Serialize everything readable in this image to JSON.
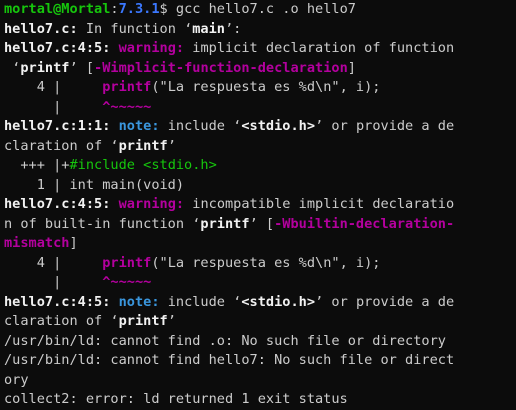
{
  "colors": {
    "background": "#0c0c0c",
    "text": "#cccccc",
    "prompt_user": "#16c60c",
    "prompt_path": "#3b78ff",
    "warning": "#b4009e",
    "note": "#3a96dd",
    "error": "#e74856",
    "fixit": "#16c60c"
  },
  "lines": [
    {
      "segments": [
        {
          "text": "mortal@Mortal",
          "style": "green b"
        },
        {
          "text": ":",
          "style": ""
        },
        {
          "text": "7.3.1",
          "style": "blue b"
        },
        {
          "text": "$ gcc hello7.c .o hello7",
          "style": ""
        }
      ]
    },
    {
      "segments": [
        {
          "text": "hello7.c:",
          "style": "white b"
        },
        {
          "text": " In function ‘",
          "style": ""
        },
        {
          "text": "main",
          "style": "white b"
        },
        {
          "text": "’:",
          "style": ""
        }
      ]
    },
    {
      "segments": [
        {
          "text": "hello7.c:4:5:",
          "style": "white b"
        },
        {
          "text": " ",
          "style": ""
        },
        {
          "text": "warning:",
          "style": "magenta b"
        },
        {
          "text": " implicit declaration of function",
          "style": ""
        }
      ]
    },
    {
      "segments": [
        {
          "text": " ‘",
          "style": ""
        },
        {
          "text": "printf",
          "style": "white b"
        },
        {
          "text": "’ [",
          "style": ""
        },
        {
          "text": "-Wimplicit-function-declaration",
          "style": "magenta b"
        },
        {
          "text": "]",
          "style": ""
        }
      ]
    },
    {
      "segments": [
        {
          "text": "    4 |     ",
          "style": ""
        },
        {
          "text": "printf",
          "style": "magenta b"
        },
        {
          "text": "(\"La respuesta es %d\\n\", i);",
          "style": ""
        }
      ]
    },
    {
      "segments": [
        {
          "text": "      |     ",
          "style": ""
        },
        {
          "text": "^~~~~~",
          "style": "magenta b"
        }
      ]
    },
    {
      "segments": [
        {
          "text": "hello7.c:1:1:",
          "style": "white b"
        },
        {
          "text": " ",
          "style": ""
        },
        {
          "text": "note:",
          "style": "cyan b"
        },
        {
          "text": " include ‘",
          "style": ""
        },
        {
          "text": "<stdio.h>",
          "style": "white b"
        },
        {
          "text": "’ or provide a de",
          "style": ""
        }
      ]
    },
    {
      "segments": [
        {
          "text": "claration of ‘",
          "style": ""
        },
        {
          "text": "printf",
          "style": "white b"
        },
        {
          "text": "’",
          "style": ""
        }
      ]
    },
    {
      "segments": [
        {
          "text": "  +++ |+",
          "style": ""
        },
        {
          "text": "#include <stdio.h>",
          "style": "green"
        }
      ]
    },
    {
      "segments": [
        {
          "text": "    1 | int main(void)",
          "style": ""
        }
      ]
    },
    {
      "segments": [
        {
          "text": "hello7.c:4:5:",
          "style": "white b"
        },
        {
          "text": " ",
          "style": ""
        },
        {
          "text": "warning:",
          "style": "magenta b"
        },
        {
          "text": " incompatible implicit declaratio",
          "style": ""
        }
      ]
    },
    {
      "segments": [
        {
          "text": "n of built-in function ‘",
          "style": ""
        },
        {
          "text": "printf",
          "style": "white b"
        },
        {
          "text": "’ [",
          "style": ""
        },
        {
          "text": "-Wbuiltin-declaration-",
          "style": "magenta b"
        }
      ]
    },
    {
      "segments": [
        {
          "text": "mismatch",
          "style": "magenta b"
        },
        {
          "text": "]",
          "style": ""
        }
      ]
    },
    {
      "segments": [
        {
          "text": "    4 |     ",
          "style": ""
        },
        {
          "text": "printf",
          "style": "magenta b"
        },
        {
          "text": "(\"La respuesta es %d\\n\", i);",
          "style": ""
        }
      ]
    },
    {
      "segments": [
        {
          "text": "      |     ",
          "style": ""
        },
        {
          "text": "^~~~~~",
          "style": "magenta b"
        }
      ]
    },
    {
      "segments": [
        {
          "text": "hello7.c:4:5:",
          "style": "white b"
        },
        {
          "text": " ",
          "style": ""
        },
        {
          "text": "note:",
          "style": "cyan b"
        },
        {
          "text": " include ‘",
          "style": ""
        },
        {
          "text": "<stdio.h>",
          "style": "white b"
        },
        {
          "text": "’ or provide a de",
          "style": ""
        }
      ]
    },
    {
      "segments": [
        {
          "text": "claration of ‘",
          "style": ""
        },
        {
          "text": "printf",
          "style": "white b"
        },
        {
          "text": "’",
          "style": ""
        }
      ]
    },
    {
      "segments": [
        {
          "text": "/usr/bin/ld: cannot find .o: No such file or directory",
          "style": ""
        }
      ]
    },
    {
      "segments": [
        {
          "text": "/usr/bin/ld: cannot find hello7: No such file or direct",
          "style": ""
        }
      ]
    },
    {
      "segments": [
        {
          "text": "ory",
          "style": ""
        }
      ]
    },
    {
      "segments": [
        {
          "text": "collect2: error: ld returned 1 exit status",
          "style": ""
        }
      ]
    }
  ]
}
